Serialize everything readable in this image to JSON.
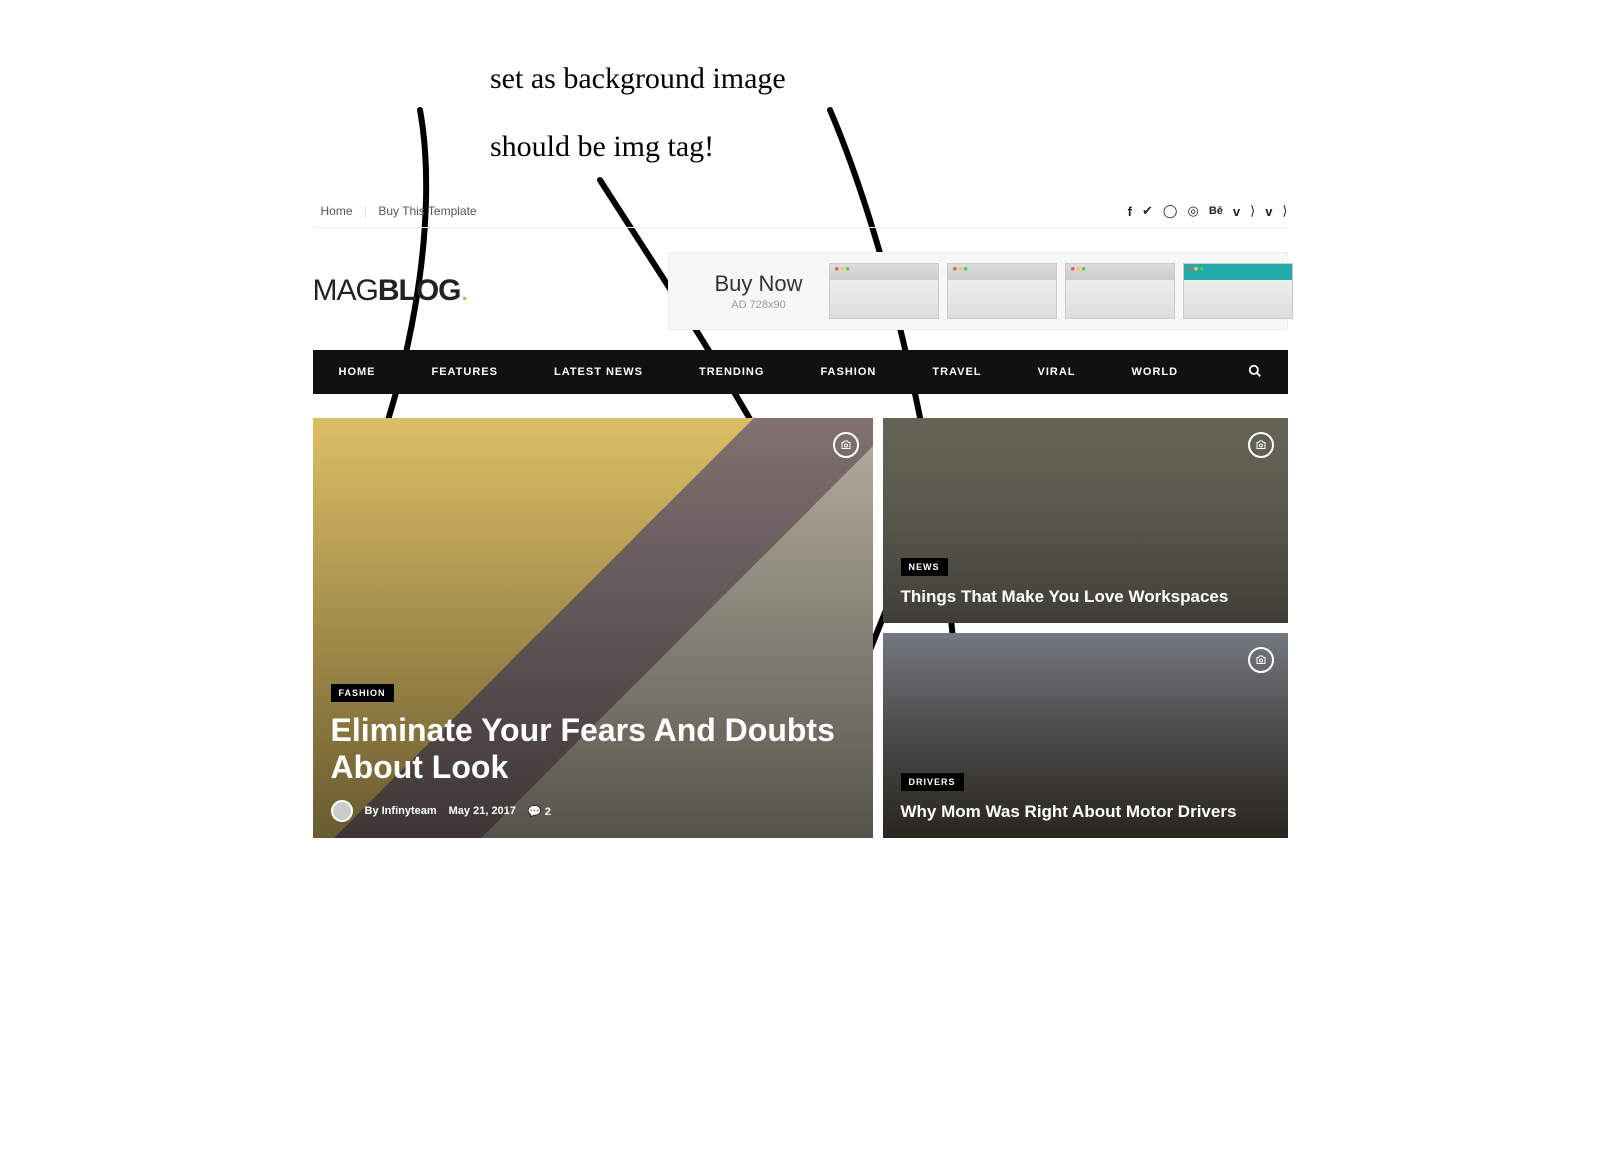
{
  "annotations": {
    "line1": "set as background image",
    "line2": "should be img tag!"
  },
  "topbar": {
    "links": [
      "Home",
      "Buy This Template"
    ]
  },
  "logo": {
    "part1": "MAG",
    "part2": "BLOG",
    "dot": "."
  },
  "ad": {
    "title": "Buy Now",
    "subtitle": "AD 728x90"
  },
  "nav": [
    "HOME",
    "FEATURES",
    "LATEST NEWS",
    "TRENDING",
    "FASHION",
    "TRAVEL",
    "VIRAL",
    "WORLD"
  ],
  "featured": {
    "main": {
      "category": "FASHION",
      "title": "Eliminate Your Fears And Doubts About Look",
      "author_prefix": "By",
      "author": "Infinyteam",
      "date": "May 21, 2017",
      "comments": "2"
    },
    "side1": {
      "category": "NEWS",
      "title": "Things That Make You Love Workspaces"
    },
    "side2": {
      "category": "DRIVERS",
      "title": "Why Mom Was Right About Motor Drivers"
    }
  }
}
